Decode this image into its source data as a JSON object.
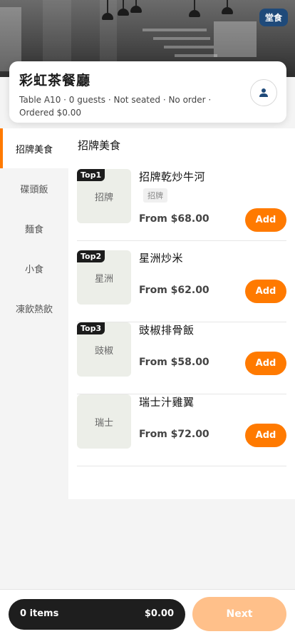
{
  "header": {
    "dine_mode_badge": "堂食"
  },
  "shop": {
    "name": "彩虹茶餐廳",
    "table_info": "Table A10 · 0 guests · Not seated · No order · Ordered $0.00"
  },
  "sidebar": {
    "items": [
      {
        "label": "招牌美食",
        "active": true
      },
      {
        "label": "碟頭飯",
        "active": false
      },
      {
        "label": "麵食",
        "active": false
      },
      {
        "label": "小食",
        "active": false
      },
      {
        "label": "凍飲熱飲",
        "active": false
      }
    ]
  },
  "main": {
    "section_title": "招牌美食",
    "items": [
      {
        "rank": "Top1",
        "thumb_text": "招牌",
        "name": "招牌乾炒牛河",
        "tag": "招牌",
        "price": "From $68.00",
        "add_label": "Add"
      },
      {
        "rank": "Top2",
        "thumb_text": "星洲",
        "name": "星洲炒米",
        "tag": "",
        "price": "From $62.00",
        "add_label": "Add"
      },
      {
        "rank": "Top3",
        "thumb_text": "豉椒",
        "name": "豉椒排骨飯",
        "tag": "",
        "price": "From $58.00",
        "add_label": "Add"
      },
      {
        "rank": "",
        "thumb_text": "瑞士",
        "name": "瑞士汁雞翼",
        "tag": "",
        "price": "From $72.00",
        "add_label": "Add"
      }
    ]
  },
  "cart": {
    "count": "0 items",
    "total": "$0.00",
    "next_label": "Next"
  },
  "colors": {
    "accent": "#ff7a00",
    "accent_disabled": "#ffc08a",
    "badge": "#1f4a7a",
    "dark": "#1e1e1e"
  },
  "icons": {
    "profile": "person-icon"
  }
}
